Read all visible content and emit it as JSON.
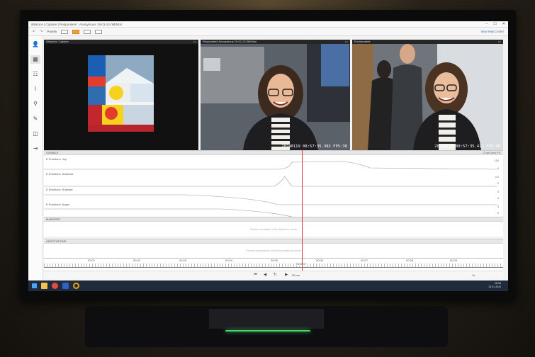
{
  "window": {
    "title": "iMotions | Capture  |  Respondent : Anonymous 19-01-24 08h54m",
    "controls": [
      "–",
      "☐",
      "✕"
    ]
  },
  "toolbar": {
    "undo": "↶",
    "redo": "↷",
    "panels_label": "Panels",
    "help_center": "View Help Center"
  },
  "sidebar": {
    "icons": [
      "person-icon",
      "video-icon",
      "sliders-icon",
      "chart-icon",
      "location-icon",
      "pen-icon",
      "chat-icon",
      "exit-icon"
    ]
  },
  "panels": {
    "stimulus": {
      "title": "Stimulus: Capture"
    },
    "respondent": {
      "title": "Respondent Anonymous 19-01-24 08h54m",
      "timestamp": "20240119 08:57:35.382 FPS:30"
    },
    "environment": {
      "title": "Environment",
      "timestamp": "20240119 08:57:35.412 FPS:30"
    }
  },
  "signals": {
    "header": "SIGNALS",
    "chart_view": "Chart view",
    "chart_view_value": "Fit",
    "rows": [
      {
        "label": "E Emotions: Joy",
        "hi": "100",
        "lo": "0"
      },
      {
        "label": "E Emotions: Sadness",
        "hi": "0.2",
        "lo": "0"
      },
      {
        "label": "E Emotions: Surprise",
        "hi": "3",
        "lo": "0"
      },
      {
        "label": "E Emotions: Anger",
        "hi": "3",
        "lo": "0"
      }
    ]
  },
  "markers": {
    "header": "MARKERS",
    "hint": "Create a marker in the Markers menu"
  },
  "annotations": {
    "header": "ANNOTATIONS",
    "hint": "Create annotations in the Annotations menu"
  },
  "timeline": {
    "ticks": [
      "00:01",
      "00:02",
      "00:03",
      "00:04",
      "00:05",
      "00:06",
      "00:07",
      "00:08",
      "00:09"
    ],
    "current": "00:05:07"
  },
  "transport": {
    "prev": "⏮",
    "back": "◀",
    "reload": "↻",
    "play": "▶",
    "speed": "50 ms",
    "zoom": "1x"
  },
  "taskbar": {
    "time": "08:58",
    "date": "19-01-2024"
  }
}
